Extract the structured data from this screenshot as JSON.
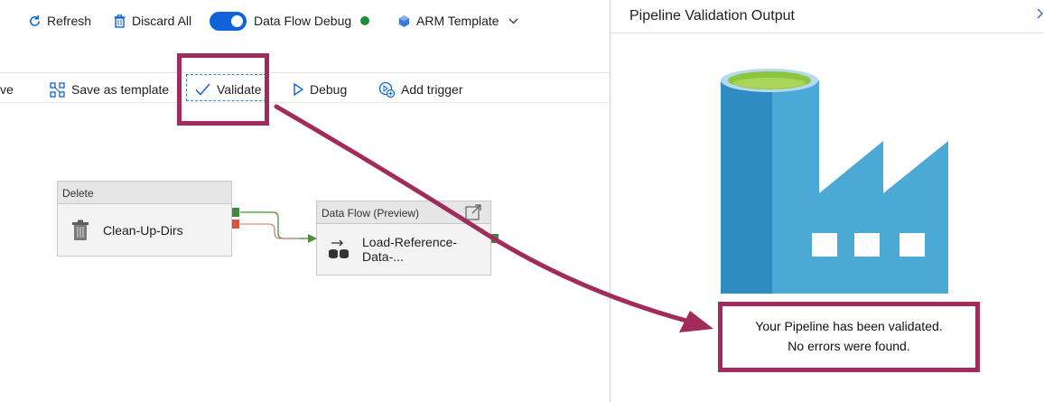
{
  "toolbar": {
    "refresh_label": "Refresh",
    "discard_label": "Discard All",
    "dataflow_debug_label": "Data Flow Debug",
    "arm_template_label": "ARM Template"
  },
  "toolbar2": {
    "save_partial_label": "ve",
    "save_template_label": "Save as template",
    "validate_label": "Validate",
    "debug_label": "Debug",
    "add_trigger_label": "Add trigger"
  },
  "activities": {
    "delete": {
      "type_label": "Delete",
      "name": "Clean-Up-Dirs"
    },
    "dataflow": {
      "type_label": "Data Flow (Preview)",
      "name": "Load-Reference-Data-..."
    }
  },
  "panel": {
    "title": "Pipeline Validation Output",
    "message_line1": "Your Pipeline has been validated.",
    "message_line2": "No errors were found."
  },
  "colors": {
    "annotation": "#a12b5b",
    "toggle": "#0f62d8",
    "status_ok": "#1a8f3a",
    "factory_blue": "#4ba9d6",
    "factory_dark": "#2f8bc2",
    "factory_top": "#8cc63f"
  },
  "icons": {
    "refresh": "refresh-icon",
    "discard": "trash-icon",
    "arm": "arm-template-icon",
    "save_template": "template-icon",
    "validate": "checkmark-icon",
    "debug": "play-icon",
    "add_trigger": "trigger-icon",
    "delete_activity": "trash-can-icon",
    "dataflow_activity": "dataflow-icon",
    "open": "open-external-icon",
    "factory": "data-factory-icon"
  }
}
